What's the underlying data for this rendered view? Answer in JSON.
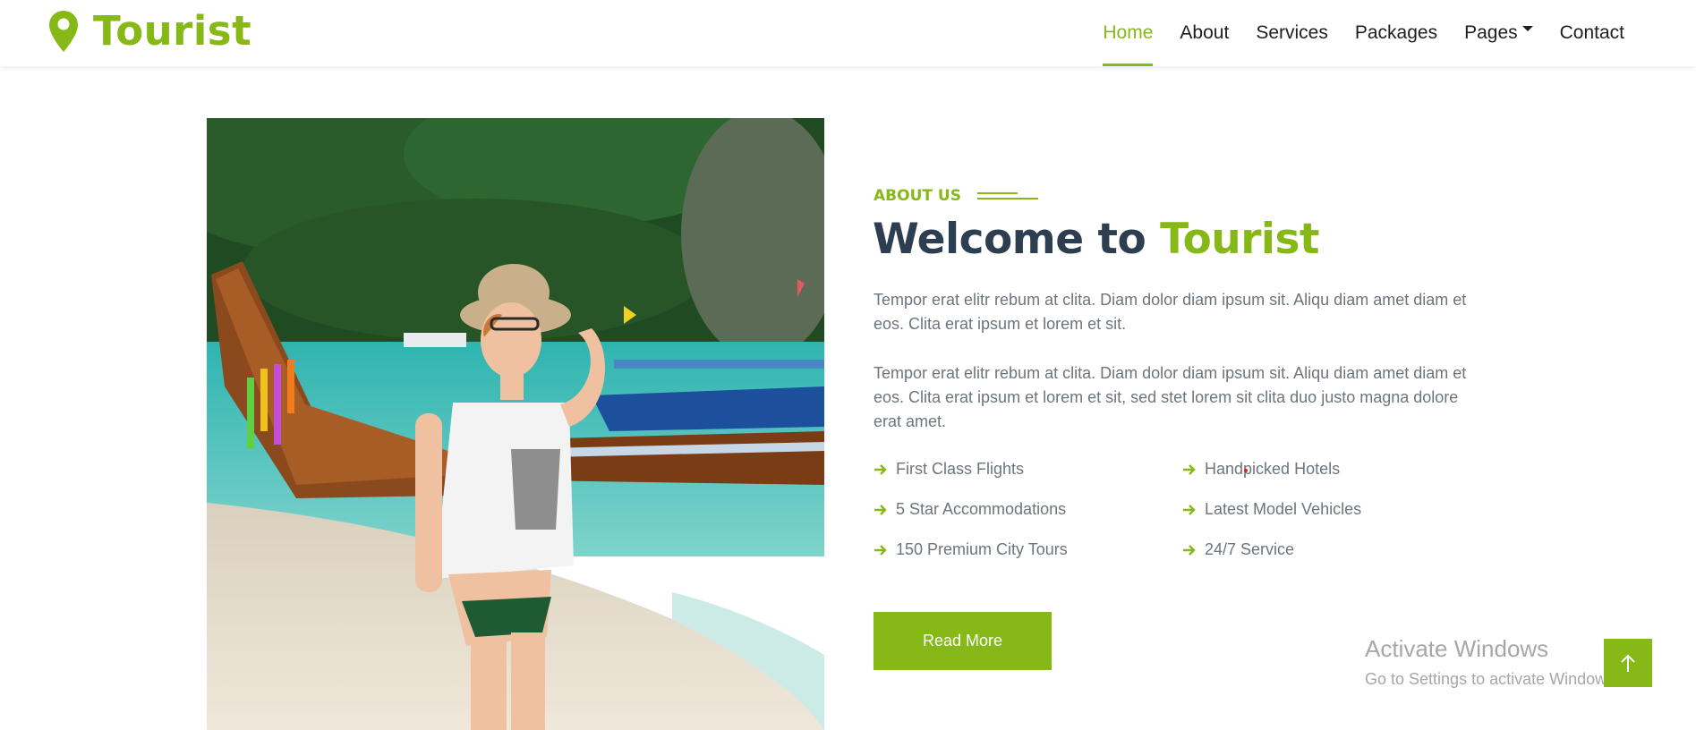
{
  "brand": {
    "name": "Tourist",
    "color": "#86B817",
    "icon": "map-marker-icon"
  },
  "nav": {
    "items": [
      {
        "label": "Home",
        "active": true
      },
      {
        "label": "About",
        "active": false
      },
      {
        "label": "Services",
        "active": false
      },
      {
        "label": "Packages",
        "active": false
      },
      {
        "label": "Pages",
        "active": false,
        "dropdown": true
      },
      {
        "label": "Contact",
        "active": false
      }
    ]
  },
  "about": {
    "section_label": "ABOUT US",
    "heading_prefix": "Welcome to ",
    "heading_accent": "Tourist",
    "paragraph1": "Tempor erat elitr rebum at clita. Diam dolor diam ipsum sit. Aliqu diam amet diam et eos. Clita erat ipsum et lorem et sit.",
    "paragraph2": "Tempor erat elitr rebum at clita. Diam dolor diam ipsum sit. Aliqu diam amet diam et eos. Clita erat ipsum et lorem et sit, sed stet lorem sit clita duo justo magna dolore erat amet.",
    "features": [
      "First Class Flights",
      "Handpicked Hotels",
      "5 Star Accommodations",
      "Latest Model Vehicles",
      "150 Premium City Tours",
      "24/7 Service"
    ],
    "button_label": "Read More"
  },
  "watermark": {
    "title": "Activate Windows",
    "subtitle": "Go to Settings to activate Windows."
  },
  "colors": {
    "primary": "#86B817",
    "heading": "#2C3E50",
    "text": "#6c757d"
  },
  "icons": {
    "feature": "arrow-right-icon",
    "back_to_top": "arrow-up-icon"
  }
}
